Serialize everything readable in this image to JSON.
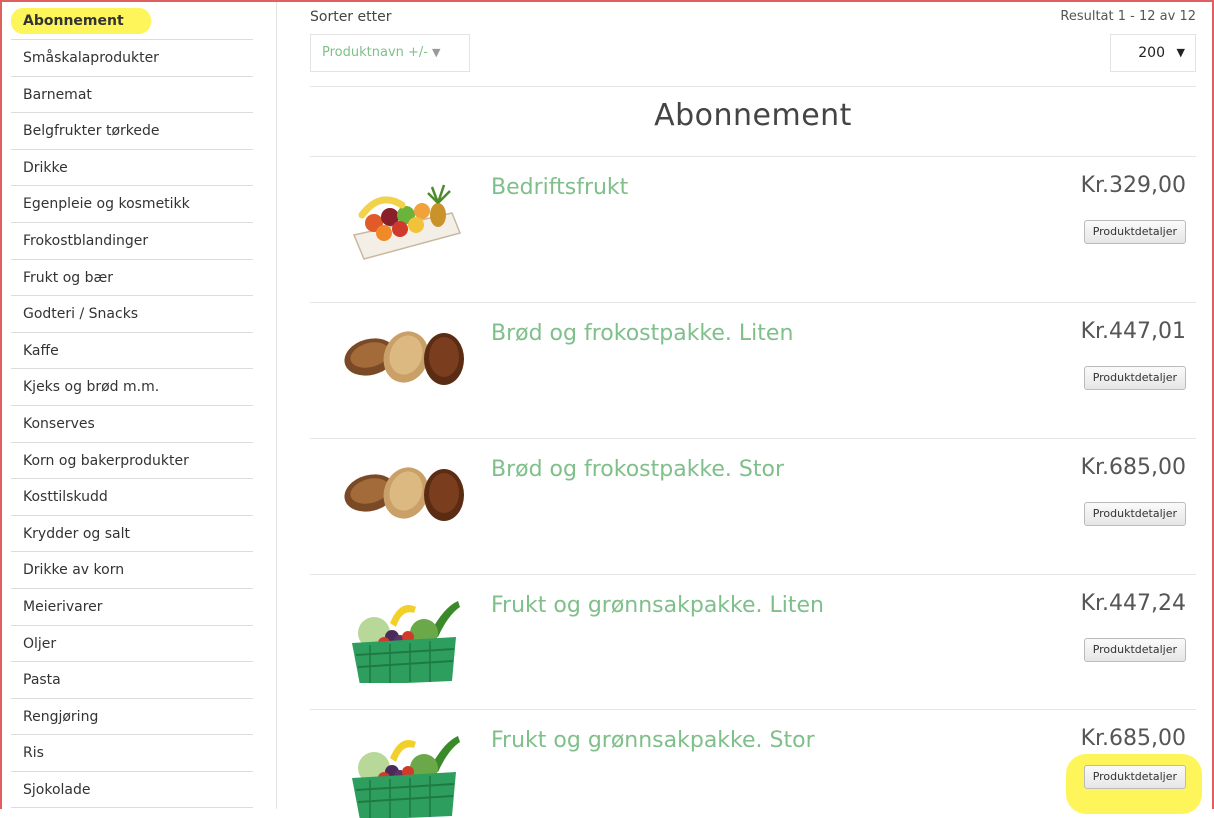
{
  "sidebar": {
    "items": [
      {
        "label": "Abonnement"
      },
      {
        "label": "Småskalaprodukter"
      },
      {
        "label": "Barnemat"
      },
      {
        "label": "Belgfrukter tørkede"
      },
      {
        "label": "Drikke"
      },
      {
        "label": "Egenpleie og kosmetikk"
      },
      {
        "label": "Frokostblandinger"
      },
      {
        "label": "Frukt og bær"
      },
      {
        "label": "Godteri / Snacks"
      },
      {
        "label": "Kaffe"
      },
      {
        "label": "Kjeks og brød m.m."
      },
      {
        "label": "Konserves"
      },
      {
        "label": "Korn og bakerprodukter"
      },
      {
        "label": "Kosttilskudd"
      },
      {
        "label": "Krydder og salt"
      },
      {
        "label": "Drikke av korn"
      },
      {
        "label": "Meierivarer"
      },
      {
        "label": "Oljer"
      },
      {
        "label": "Pasta"
      },
      {
        "label": "Rengjøring"
      },
      {
        "label": "Ris"
      },
      {
        "label": "Sjokolade"
      }
    ]
  },
  "sort": {
    "label": "Sorter etter",
    "field": "Produktnavn +/-",
    "arrow_icon": "down-arrow-icon"
  },
  "results": {
    "text": "Resultat 1 - 12 av 12",
    "per_page": "200",
    "caret": "▼"
  },
  "category_title": "Abonnement",
  "products": [
    {
      "name": "Bedriftsfrukt",
      "price": "Kr.329,00",
      "button": "Produktdetaljer",
      "image": "fruit-basket-image"
    },
    {
      "name": "Brød og frokostpakke. Liten",
      "price": "Kr.447,01",
      "button": "Produktdetaljer",
      "image": "bread-image"
    },
    {
      "name": "Brød og frokostpakke. Stor",
      "price": "Kr.685,00",
      "button": "Produktdetaljer",
      "image": "bread-image"
    },
    {
      "name": "Frukt og grønnsakpakke. Liten",
      "price": "Kr.447,24",
      "button": "Produktdetaljer",
      "image": "vegetable-crate-image"
    },
    {
      "name": "Frukt og grønnsakpakke. Stor",
      "price": "Kr.685,00",
      "button": "Produktdetaljer",
      "image": "vegetable-crate-image"
    }
  ],
  "colors": {
    "accent_green": "#7fbf8a",
    "highlight_yellow": "#fdf55a",
    "frame_red": "#e06060"
  }
}
